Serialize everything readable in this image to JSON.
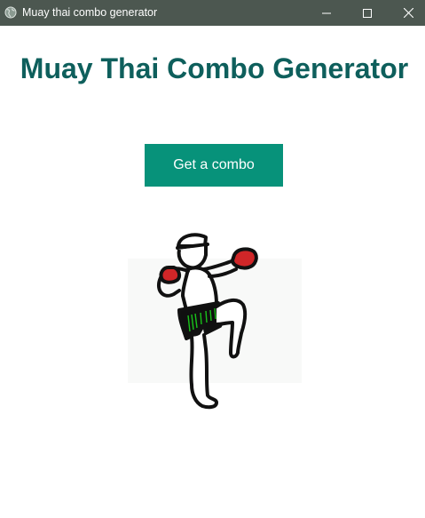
{
  "window": {
    "title": "Muay thai combo generator",
    "titlebar_color": "#4c5750",
    "icons": {
      "app": "globe-icon",
      "minimize": "minimize-icon",
      "maximize": "maximize-icon",
      "close": "close-icon"
    }
  },
  "main": {
    "heading": "Muay Thai Combo Generator",
    "heading_color": "#0e5f5c",
    "button_label": "Get a combo",
    "button_color": "#07927a",
    "illustration": "muay-thai-fighter-knee-strike"
  }
}
